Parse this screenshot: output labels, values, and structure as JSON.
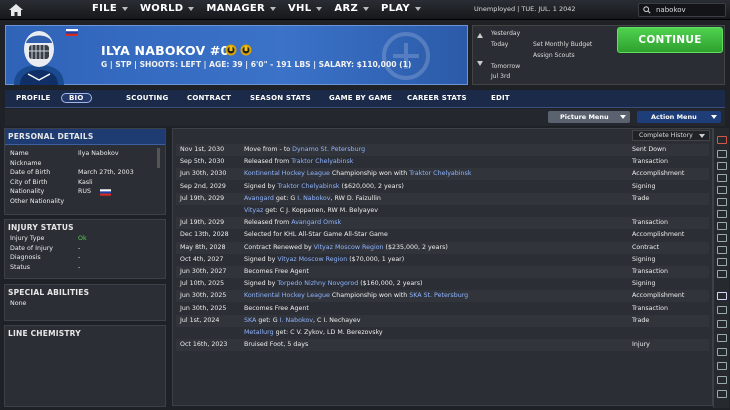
{
  "topbar": {
    "menus": [
      "FILE",
      "WORLD",
      "MANAGER",
      "VHL",
      "ARZ",
      "PLAY"
    ],
    "status": "Unemployed | TUE. JUL. 1 2042",
    "search_value": "nabokov"
  },
  "player": {
    "name": "ILYA NABOKOV #0",
    "meta": "G | STP | SHOOTS: LEFT | AGE: 39 | 6'0\" - 191 LBS | SALARY: $110,000 (1)"
  },
  "calendar": {
    "yesterday_label": "Yesterday",
    "today_label": "Today",
    "today_items": [
      "Set Monthly Budget",
      "Assign Scouts"
    ],
    "tomorrow_label": "Tomorrow",
    "tomorrow_date": "Jul 3rd",
    "continue_label": "CONTINUE"
  },
  "tabs": [
    "PROFILE",
    "BIO",
    "SCOUTING",
    "CONTRACT",
    "SEASON STATS",
    "GAME BY GAME",
    "CAREER STATS",
    "EDIT"
  ],
  "subbar": {
    "picture_menu": "Picture Menu",
    "action_menu": "Action Menu"
  },
  "personal": {
    "title": "PERSONAL DETAILS",
    "rows": [
      {
        "k": "Name",
        "v": "Ilya Nabokov"
      },
      {
        "k": "Nickname",
        "v": ""
      },
      {
        "k": "Date of Birth",
        "v": "March 27th, 2003"
      },
      {
        "k": "City of Birth",
        "v": "Kasli"
      },
      {
        "k": "Nationality",
        "v": "RUS"
      },
      {
        "k": "Other Nationality",
        "v": ""
      }
    ]
  },
  "injury": {
    "title": "INJURY STATUS",
    "rows": [
      {
        "k": "Injury Type",
        "v": "Ok"
      },
      {
        "k": "Date of Injury",
        "v": "-"
      },
      {
        "k": "Diagnosis",
        "v": "-"
      },
      {
        "k": "Status",
        "v": "-"
      }
    ]
  },
  "special": {
    "title": "SPECIAL ABILITIES",
    "value": "None"
  },
  "chemistry": {
    "title": "LINE CHEMISTRY"
  },
  "history": {
    "selector": "Complete History",
    "rows": [
      {
        "d": "Nov 1st, 2030",
        "parts": [
          {
            "t": "Move from - to "
          },
          {
            "t": "Dynamo St. Petersburg",
            "l": true
          }
        ],
        "ty": "Sent Down"
      },
      {
        "d": "Sep 5th, 2030",
        "parts": [
          {
            "t": "Released from "
          },
          {
            "t": "Traktor Chelyabinsk",
            "l": true
          }
        ],
        "ty": "Transaction"
      },
      {
        "d": "Jun 30th, 2030",
        "parts": [
          {
            "t": "Kontinental Hockey League",
            "l": true
          },
          {
            "t": " Championship won with "
          },
          {
            "t": "Traktor Chelyabinsk",
            "l": true
          }
        ],
        "ty": "Accomplishment"
      },
      {
        "d": "Sep 2nd, 2029",
        "parts": [
          {
            "t": "Signed by "
          },
          {
            "t": "Traktor Chelyabinsk",
            "l": true
          },
          {
            "t": " ($620,000, 2 years)"
          }
        ],
        "ty": "Signing"
      },
      {
        "d": "Jul 19th, 2029",
        "parts": [
          {
            "t": "Avangard",
            "l": true
          },
          {
            "t": " get: G "
          },
          {
            "t": "I. Nabokov",
            "l": true
          },
          {
            "t": ", RW D. Faizullin"
          }
        ],
        "ty": "Trade"
      },
      {
        "d": "",
        "parts": [
          {
            "t": "Vityaz",
            "l": true
          },
          {
            "t": " get: C J. Koppanen, RW M. Belyayev"
          }
        ],
        "ty": ""
      },
      {
        "d": "Jul 19th, 2029",
        "parts": [
          {
            "t": "Released from "
          },
          {
            "t": "Avangard Omsk",
            "l": true
          }
        ],
        "ty": "Transaction"
      },
      {
        "d": "Dec 13th, 2028",
        "parts": [
          {
            "t": "Selected for KHL All-Star Game All-Star Game"
          }
        ],
        "ty": "Accomplishment"
      },
      {
        "d": "May 8th, 2028",
        "parts": [
          {
            "t": "Contract Renewed by "
          },
          {
            "t": "Vityaz Moscow Region",
            "l": true
          },
          {
            "t": " ($235,000, 2 years)"
          }
        ],
        "ty": "Contract"
      },
      {
        "d": "Oct 4th, 2027",
        "parts": [
          {
            "t": "Signed by "
          },
          {
            "t": "Vityaz Moscow Region",
            "l": true
          },
          {
            "t": " ($70,000, 1 year)"
          }
        ],
        "ty": "Signing"
      },
      {
        "d": "Jun 30th, 2027",
        "parts": [
          {
            "t": "Becomes Free Agent"
          }
        ],
        "ty": "Transaction"
      },
      {
        "d": "Jul 10th, 2025",
        "parts": [
          {
            "t": "Signed by "
          },
          {
            "t": "Torpedo Nizhny Novgorod",
            "l": true
          },
          {
            "t": " ($160,000, 2 years)"
          }
        ],
        "ty": "Signing"
      },
      {
        "d": "Jun 30th, 2025",
        "parts": [
          {
            "t": "Kontinental Hockey League",
            "l": true
          },
          {
            "t": " Championship won with "
          },
          {
            "t": "SKA St. Petersburg",
            "l": true
          }
        ],
        "ty": "Accomplishment"
      },
      {
        "d": "Jun 30th, 2025",
        "parts": [
          {
            "t": "Becomes Free Agent"
          }
        ],
        "ty": "Transaction"
      },
      {
        "d": "Jul 1st, 2024",
        "parts": [
          {
            "t": "SKA",
            "l": true
          },
          {
            "t": " get: G "
          },
          {
            "t": "I. Nabokov",
            "l": true
          },
          {
            "t": ", C I. Nechayev"
          }
        ],
        "ty": "Trade"
      },
      {
        "d": "",
        "parts": [
          {
            "t": "Metallurg",
            "l": true
          },
          {
            "t": " get: C V. Zykov, LD M. Berezovsky"
          }
        ],
        "ty": ""
      },
      {
        "d": "Oct 16th, 2023",
        "parts": [
          {
            "t": "Bruised Foot, 5 days"
          }
        ],
        "ty": "Injury"
      }
    ]
  },
  "colors": {
    "accent": "#3b73c9",
    "continue": "#3cb83c",
    "link": "#8fb4ff",
    "ok": "#4fd24f"
  }
}
